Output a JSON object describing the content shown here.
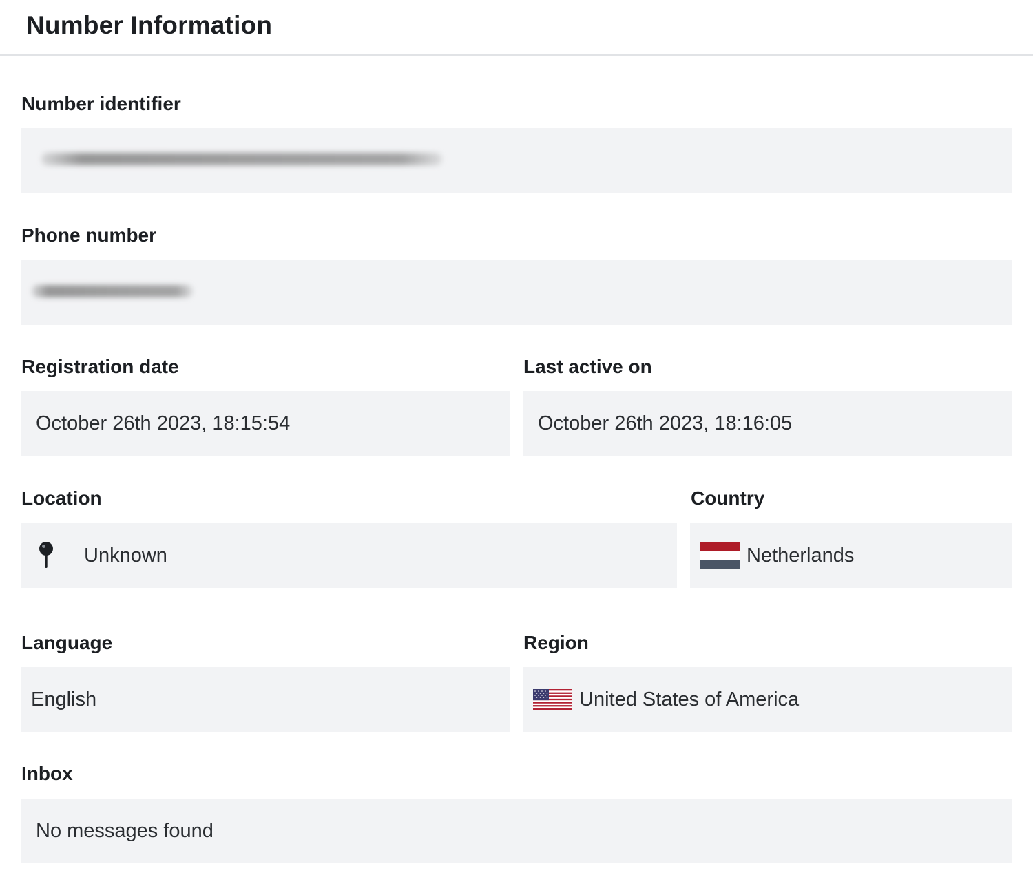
{
  "header": {
    "title": "Number Information"
  },
  "fields": {
    "number_identifier": {
      "label": "Number identifier",
      "value": ""
    },
    "phone_number": {
      "label": "Phone number",
      "value": ""
    },
    "registration_date": {
      "label": "Registration date",
      "value": "October 26th 2023, 18:15:54"
    },
    "last_active_on": {
      "label": "Last active on",
      "value": "October 26th 2023, 18:16:05"
    },
    "location": {
      "label": "Location",
      "value": "Unknown",
      "icon": "pin-icon"
    },
    "country": {
      "label": "Country",
      "value": "Netherlands",
      "icon": "netherlands-flag-icon"
    },
    "language": {
      "label": "Language",
      "value": "English"
    },
    "region": {
      "label": "Region",
      "value": "United States of America",
      "icon": "usa-flag-icon"
    },
    "inbox": {
      "label": "Inbox",
      "value": "No messages found"
    }
  },
  "colors": {
    "field_background": "#f2f3f5",
    "nl_red": "#ae1c28",
    "nl_blue": "#4a5566"
  }
}
